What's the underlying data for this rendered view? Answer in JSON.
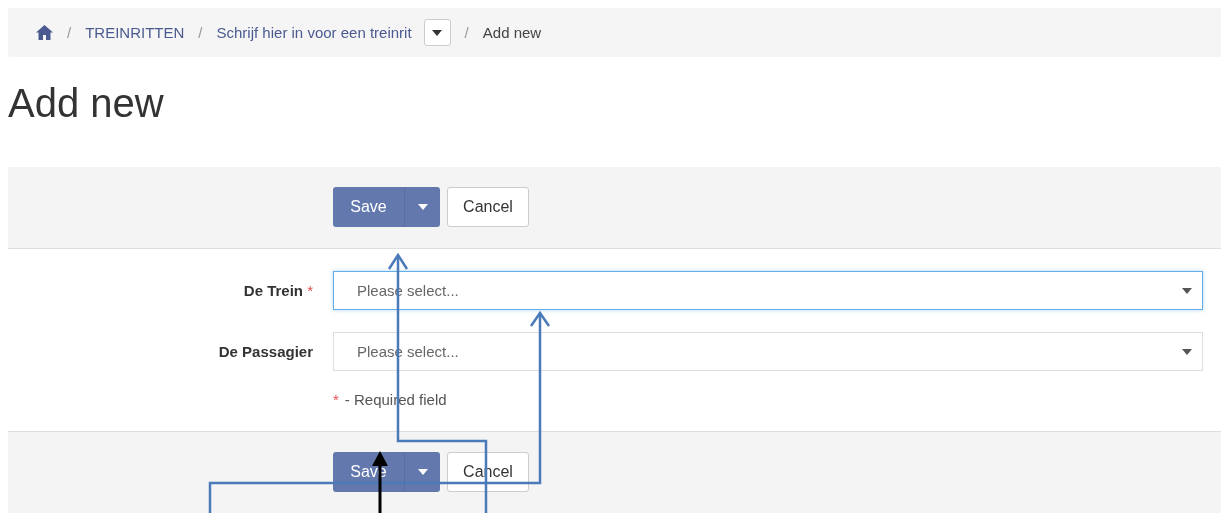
{
  "breadcrumb": {
    "separator": "/",
    "items": [
      {
        "kind": "home"
      },
      {
        "kind": "link",
        "label": "TREINRITTEN"
      },
      {
        "kind": "dropdown",
        "label": "Schrijf hier in voor een treinrit"
      },
      {
        "kind": "current",
        "label": "Add new"
      }
    ]
  },
  "heading": "Add new",
  "top_toolbar": {
    "save": "Save",
    "cancel": "Cancel"
  },
  "fields": [
    {
      "label": "De Trein",
      "required_mark": "*",
      "placeholder": "Please select...",
      "focused": true
    },
    {
      "label": "De Passagier",
      "placeholder": "Please select...",
      "focused": false
    }
  ],
  "required_note": {
    "mark": "*",
    "text": "- Required field"
  },
  "bottom_toolbar": {
    "save": "Save",
    "cancel": "Cancel"
  }
}
